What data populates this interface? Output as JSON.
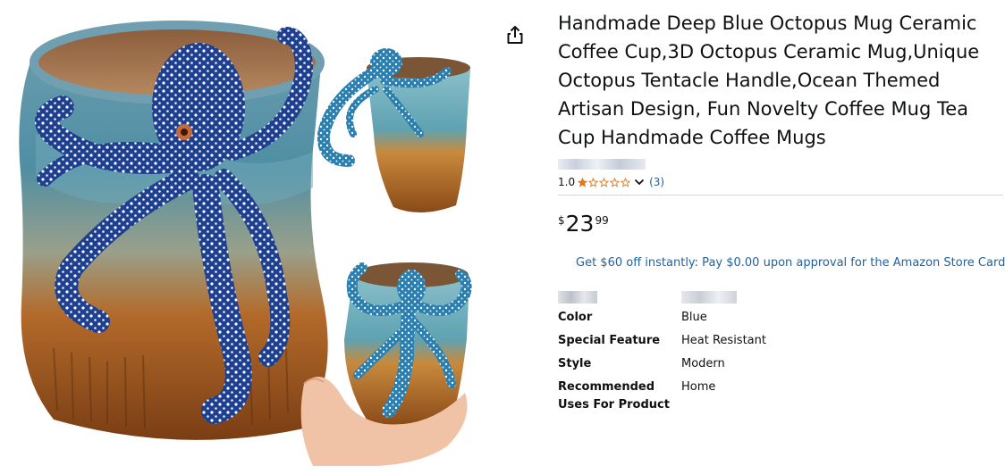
{
  "product": {
    "title": "Handmade Deep Blue Octopus Mug Ceramic Coffee Cup,3D Octopus Ceramic Mug,Unique Octopus Tentacle Handle,Ocean Themed Artisan Design, Fun Novelty Coffee Mug Tea Cup Handmade Coffee Mugs",
    "rating_value": "1.0",
    "rating_stars": 1,
    "rating_count": "(3)",
    "price": {
      "symbol": "$",
      "whole": "23",
      "fraction": "99"
    },
    "promo": "Get $60 off instantly: Pay $0.00 upon approval for the Amazon Store Card."
  },
  "specs": [
    {
      "key": "Color",
      "value": "Blue"
    },
    {
      "key": "Special Feature",
      "value": "Heat Resistant"
    },
    {
      "key": "Style",
      "value": "Modern"
    },
    {
      "key": "Recommended Uses For Product",
      "value": "Home"
    }
  ],
  "colors": {
    "link": "#2162a1",
    "star": "#de7921",
    "divider": "#d5d9d9"
  },
  "icons": {
    "share": "share-icon",
    "chevron": "chevron-down-icon",
    "star": "star-icon"
  }
}
